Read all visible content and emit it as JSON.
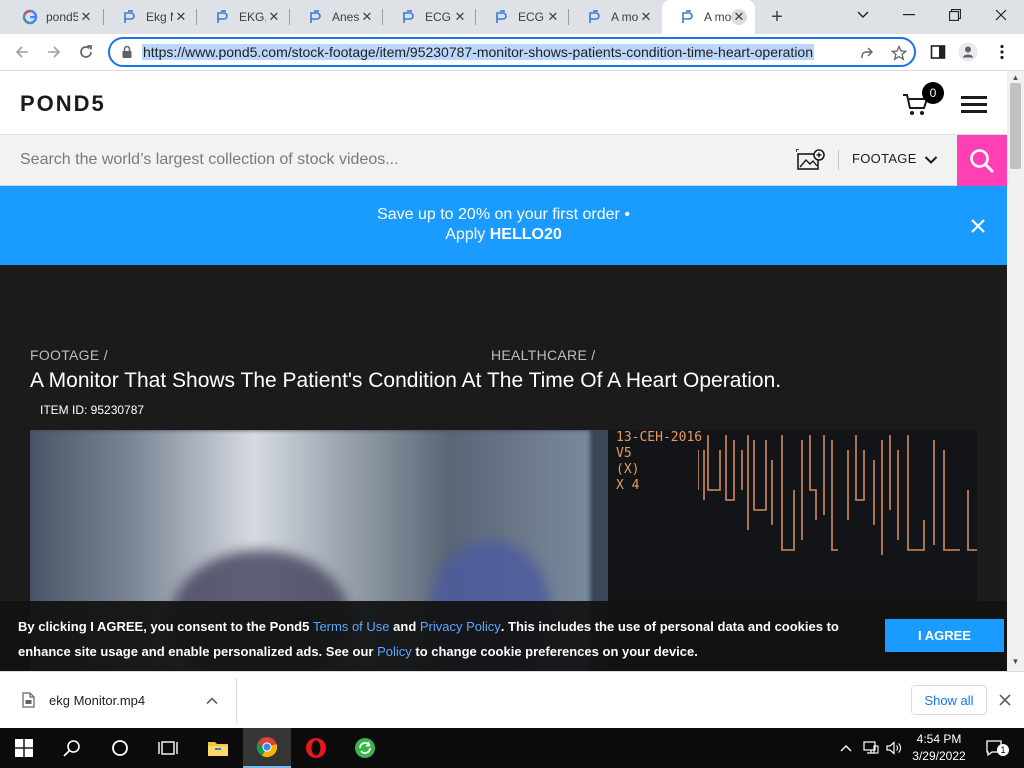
{
  "browser": {
    "tabs": [
      {
        "title": "pond5",
        "favicon": "google-icon"
      },
      {
        "title": "Ekg M",
        "favicon": "pond5-icon"
      },
      {
        "title": "EKG, ",
        "favicon": "pond5-icon"
      },
      {
        "title": "Anest",
        "favicon": "pond5-icon"
      },
      {
        "title": "ECG r",
        "favicon": "pond5-icon"
      },
      {
        "title": "ECG c",
        "favicon": "pond5-icon"
      },
      {
        "title": "A mo",
        "favicon": "pond5-icon"
      },
      {
        "title": "A mo",
        "favicon": "pond5-icon",
        "active": true
      }
    ],
    "url": "https://www.pond5.com/stock-footage/item/95230787-monitor-shows-patients-condition-time-heart-operation"
  },
  "site": {
    "logo": "POND5",
    "cart_count": "0",
    "search_placeholder": "Search the world’s largest collection of stock videos...",
    "filter_label": "FOOTAGE",
    "accent": "#ff3fb4"
  },
  "promo": {
    "line1": "Save up to 20% on your first order •",
    "line2_prefix": "Apply ",
    "code": "HELLO20",
    "bg": "#1a9bff"
  },
  "item": {
    "breadcrumb_1": "FOOTAGE /",
    "breadcrumb_2": "HEALTHCARE /",
    "title": "A Monitor That Shows The Patient's Condition At The Time Of A Heart Operation.",
    "item_id": "ITEM ID: 95230787",
    "monitor_text": "13-CEH-2016\nV5\n(X)\nX 4"
  },
  "cookie": {
    "text_1": "By clicking I AGREE, you consent to the Pond5 ",
    "terms_link": "Terms of Use",
    "text_2": " and ",
    "privacy_link": "Privacy Policy",
    "text_3": ". This includes the use of personal data and cookies to enhance site usage and enable personalized ads. See our ",
    "policy_link": "Policy",
    "text_4": " to change cookie preferences on your device.",
    "agree_label": "I AGREE"
  },
  "download": {
    "file_name": "ekg Monitor.mp4",
    "show_all_label": "Show all"
  },
  "taskbar": {
    "time": "4:54 PM",
    "date": "3/29/2022",
    "notification_count": "1"
  }
}
